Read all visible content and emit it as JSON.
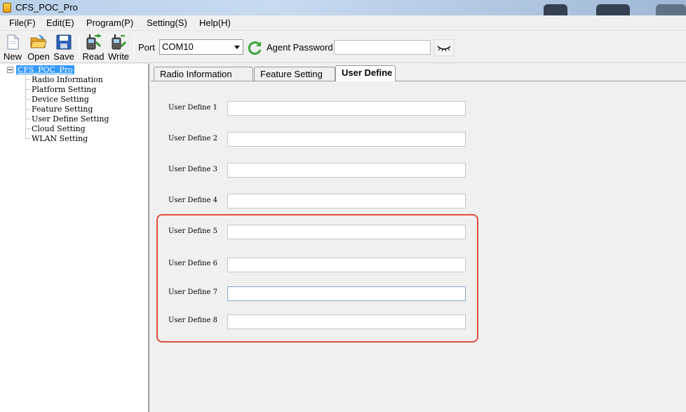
{
  "window": {
    "title": "CFS_POC_Pro"
  },
  "menu": [
    "File(F)",
    "Edit(E)",
    "Program(P)",
    "Setting(S)",
    "Help(H)"
  ],
  "toolbar": {
    "new_label": "New",
    "open_label": "Open",
    "save_label": "Save",
    "read_label": "Read",
    "write_label": "Write",
    "port_label": "Port",
    "port_value": "COM10",
    "agent_password_label": "Agent Password",
    "agent_password_value": ""
  },
  "tree": {
    "root": "CFS_POC_Pro",
    "items": [
      "Radio Information",
      "Platform Setting",
      "Device Setting",
      "Feature Setting",
      "User Define Setting",
      "Cloud Setting",
      "WLAN Setting"
    ]
  },
  "tabs": [
    "Radio Information",
    "Feature Setting",
    "User Define"
  ],
  "active_tab": "User Define",
  "fields": [
    {
      "label": "User Define 1",
      "value": ""
    },
    {
      "label": "User Define 2",
      "value": ""
    },
    {
      "label": "User Define 3",
      "value": ""
    },
    {
      "label": "User Define 4",
      "value": ""
    },
    {
      "label": "User Define 5",
      "value": ""
    },
    {
      "label": "User Define 6",
      "value": ""
    },
    {
      "label": "User Define 7",
      "value": ""
    },
    {
      "label": "User Define 8",
      "value": ""
    }
  ],
  "colors": {
    "highlight": "#e14b3b",
    "tree_selection": "#3399ff"
  },
  "icons": [
    "new-file-icon",
    "open-folder-icon",
    "save-disk-icon",
    "read-radio-icon",
    "write-radio-icon",
    "refresh-icon",
    "eye-closed-icon",
    "dropdown-arrow-icon"
  ]
}
